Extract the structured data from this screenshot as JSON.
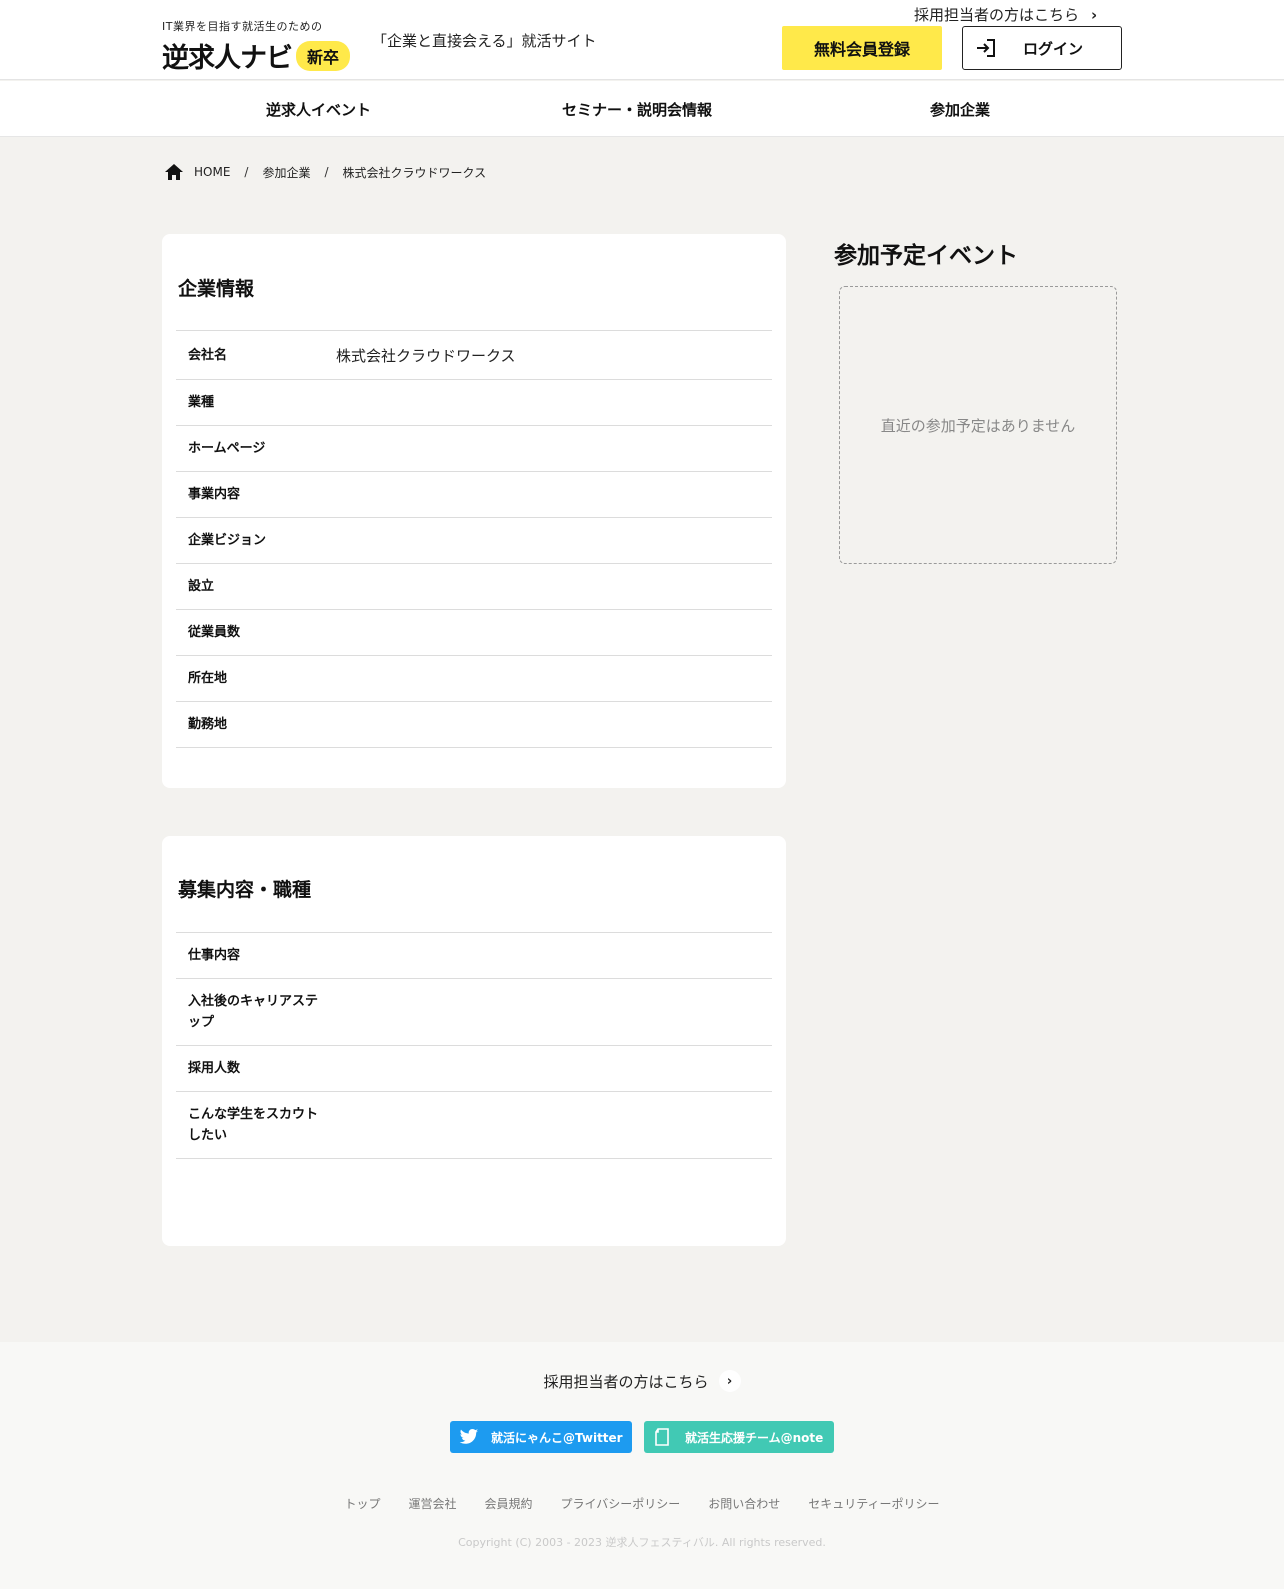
{
  "header": {
    "tagline": "IT業界を目指す就活生のための",
    "logo_name": "逆求人ナビ",
    "logo_badge": "新卒",
    "catchphrase": "「企業と直接会える」就活サイト",
    "recruiter_link": "採用担当者の方はこちら",
    "register_button": "無料会員登録",
    "login_button": "ログイン"
  },
  "nav": {
    "items": [
      "逆求人イベント",
      "セミナー・説明会情報",
      "参加企業"
    ]
  },
  "breadcrumb": {
    "home": "HOME",
    "sep": "/",
    "level1": "参加企業",
    "current": "株式会社クラウドワークス"
  },
  "company_info": {
    "title": "企業情報",
    "rows": [
      {
        "label": "会社名",
        "value": "株式会社クラウドワークス"
      },
      {
        "label": "業種",
        "value": ""
      },
      {
        "label": "ホームページ",
        "value": ""
      },
      {
        "label": "事業内容",
        "value": ""
      },
      {
        "label": "企業ビジョン",
        "value": ""
      },
      {
        "label": "設立",
        "value": ""
      },
      {
        "label": "従業員数",
        "value": ""
      },
      {
        "label": "所在地",
        "value": ""
      },
      {
        "label": "勤務地",
        "value": ""
      }
    ]
  },
  "recruitment": {
    "title": "募集内容・職種",
    "rows": [
      {
        "label": "仕事内容",
        "value": ""
      },
      {
        "label": "入社後のキャリアステップ",
        "value": ""
      },
      {
        "label": "採用人数",
        "value": ""
      },
      {
        "label": "こんな学生をスカウトしたい",
        "value": ""
      }
    ]
  },
  "events": {
    "title": "参加予定イベント",
    "empty_message": "直近の参加予定はありません"
  },
  "footer": {
    "recruiter_link": "採用担当者の方はこちら",
    "twitter_button": "就活にゃんこ@Twitter",
    "note_button": "就活生応援チーム@note",
    "links": [
      "トップ",
      "運営会社",
      "会員規約",
      "プライバシーポリシー",
      "お問い合わせ",
      "セキュリティーポリシー"
    ],
    "copyright": "Copyright (C) 2003 - 2023 逆求人フェスティバル. All rights reserved."
  },
  "colors": {
    "accent_yellow": "#ffe94a",
    "twitter_blue": "#1d9bf0",
    "note_green": "#41c9b4",
    "page_bg": "#f3f2ef"
  }
}
